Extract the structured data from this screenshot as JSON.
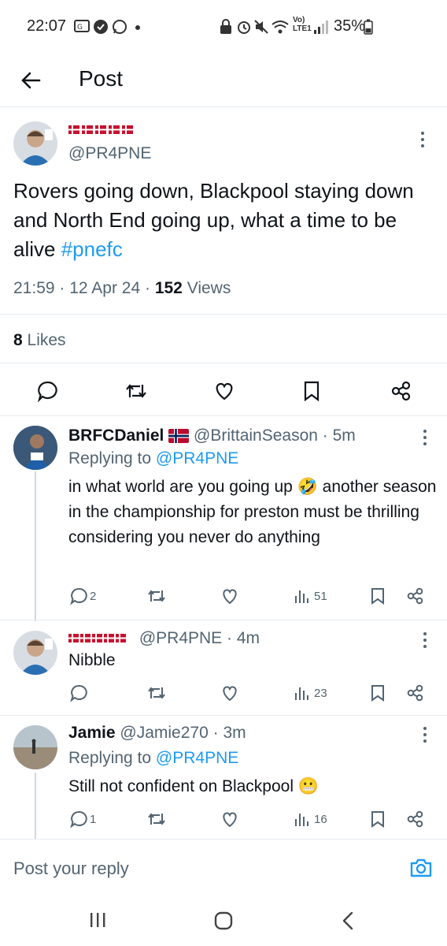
{
  "status_bar": {
    "time": "22:07",
    "battery": "35%",
    "network": "LTE1"
  },
  "header": {
    "title": "Post"
  },
  "main_post": {
    "handle": "@PR4PNE",
    "text": "Rovers going down, Blackpool staying down and North End going up, what a time to be alive ",
    "hashtag": "#pnefc",
    "time": "21:59",
    "date": "12 Apr 24",
    "views_count": "152",
    "views_label": "Views",
    "likes_count": "8",
    "likes_label": "Likes"
  },
  "replies": [
    {
      "name": "BRFCDaniel",
      "handle": "@BrittainSeason",
      "time": "5m",
      "replying_prefix": "Replying to",
      "replying_to": "@PR4PNE",
      "text": "in what world are you going up 🤣 another season in the championship for preston must be thrilling considering you never do anything",
      "reply_count": "2",
      "views": "51"
    },
    {
      "handle": "@PR4PNE",
      "time": "4m",
      "text": "Nibble",
      "views": "23"
    },
    {
      "name": "Jamie",
      "handle": "@Jamie270",
      "time": "3m",
      "replying_prefix": "Replying to",
      "replying_to": "@PR4PNE",
      "text": "Still not confident on Blackpool 😬",
      "reply_count": "1",
      "views": "16"
    }
  ],
  "reply_bar": {
    "placeholder": "Post your reply"
  },
  "colors": {
    "accent": "#1d9bf0",
    "text": "#0f1419",
    "secondary": "#536471",
    "divider": "#e6ecf0"
  }
}
